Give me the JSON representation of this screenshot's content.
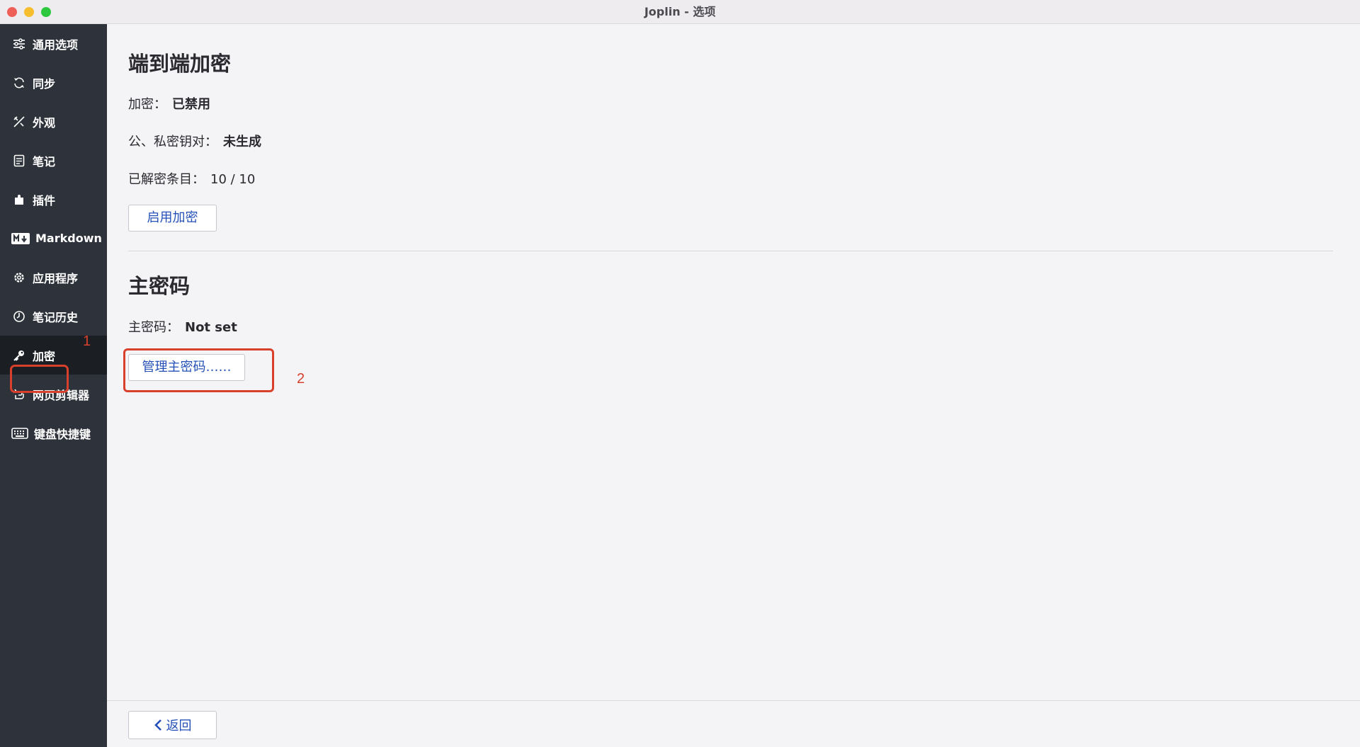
{
  "window": {
    "title": "Joplin - 选项"
  },
  "sidebar": {
    "items": [
      {
        "label": "通用选项",
        "icon": "sliders-icon"
      },
      {
        "label": "同步",
        "icon": "sync-icon"
      },
      {
        "label": "外观",
        "icon": "appearance-icon"
      },
      {
        "label": "笔记",
        "icon": "note-icon"
      },
      {
        "label": "插件",
        "icon": "puzzle-icon"
      },
      {
        "label": "Markdown",
        "icon": "markdown-icon"
      },
      {
        "label": "应用程序",
        "icon": "gear-icon"
      },
      {
        "label": "笔记历史",
        "icon": "history-icon"
      },
      {
        "label": "加密",
        "icon": "key-icon",
        "active": true
      },
      {
        "label": "网页剪辑器",
        "icon": "clipper-icon"
      },
      {
        "label": "键盘快捷键",
        "icon": "keyboard-icon"
      }
    ]
  },
  "annotations": {
    "marker1": "1",
    "marker2": "2"
  },
  "encryption": {
    "title": "端到端加密",
    "status_label": "加密：",
    "status_value": "已禁用",
    "keypair_label": "公、私密钥对：",
    "keypair_value": "未生成",
    "decrypted_label": "已解密条目：",
    "decrypted_value": "10 / 10",
    "enable_button": "启用加密"
  },
  "master_password": {
    "title": "主密码",
    "label": "主密码：",
    "value": "Not set",
    "manage_button": "管理主密码……"
  },
  "footer": {
    "back_label": "返回"
  },
  "colors": {
    "sidebar_bg": "#2d323b",
    "sidebar_active_bg": "#1b1e23",
    "annotation": "#d8402b",
    "link_blue": "#2450b8"
  }
}
